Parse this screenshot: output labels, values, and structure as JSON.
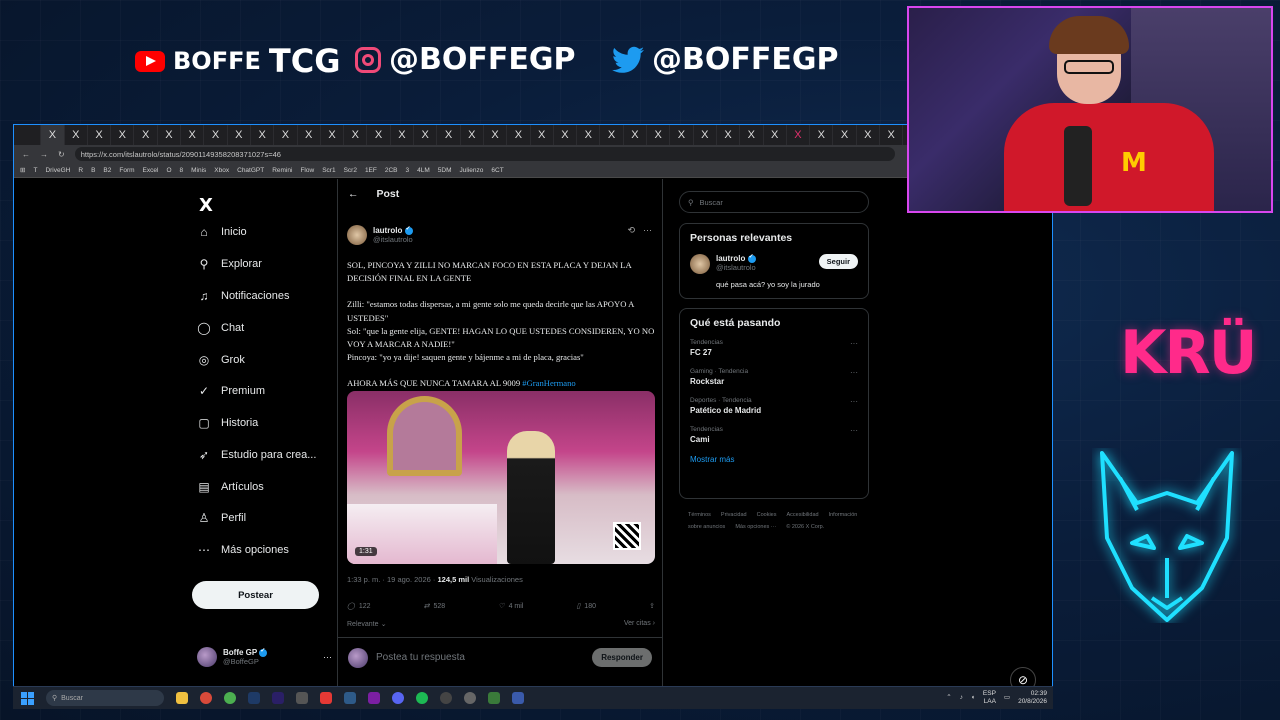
{
  "overlay": {
    "youtube": {
      "prefix": "BOFFE",
      "main": "TCG",
      "icon": "youtube-icon"
    },
    "instagram": {
      "handle": "@BOFFEGP",
      "icon": "instagram-icon"
    },
    "twitter": {
      "handle": "@BOFFEGP",
      "icon": "twitter-icon"
    },
    "kru_logo": "KRÜ",
    "accent_pink": "#ff2a8a",
    "accent_cyan": "#1fe0ff"
  },
  "browser": {
    "url": "https://x.com/itslautrolo/status/20901149358208371027s=46",
    "tabs": [
      "",
      "X",
      "X",
      "X",
      "X",
      "X",
      "X",
      "X",
      "X",
      "X",
      "X",
      "X",
      "X",
      "X",
      "X",
      "X",
      "X",
      "X",
      "X",
      "X",
      "X",
      "X",
      "X",
      "X",
      "X",
      "X",
      "X",
      "X",
      "X",
      "X",
      "X",
      "X",
      "X",
      "X",
      "X",
      "X",
      "X",
      "X",
      "X"
    ],
    "bookmarks": [
      "T",
      "DriveGH",
      "R",
      "B",
      "B2",
      "Form",
      "Excel",
      "O",
      "8",
      "Minis",
      "Xbox",
      "ChatGPT",
      "Remini",
      "Flow",
      "Scr1",
      "Scr2",
      "1EF",
      "2CB",
      "3",
      "4LM",
      "5DM",
      "Julienzo",
      "6CT"
    ]
  },
  "nav": {
    "logo": "X",
    "items": [
      {
        "label": "Inicio",
        "icon": "home-icon",
        "glyph": "⌂"
      },
      {
        "label": "Explorar",
        "icon": "search-icon",
        "glyph": "⚲"
      },
      {
        "label": "Notificaciones",
        "icon": "bell-icon",
        "glyph": "♫"
      },
      {
        "label": "Chat",
        "icon": "chat-icon",
        "glyph": "◯"
      },
      {
        "label": "Grok",
        "icon": "grok-icon",
        "glyph": "◎"
      },
      {
        "label": "Premium",
        "icon": "premium-icon",
        "glyph": "✓"
      },
      {
        "label": "Historia",
        "icon": "history-icon",
        "glyph": "▢"
      },
      {
        "label": "Estudio para crea...",
        "icon": "studio-icon",
        "glyph": "➶"
      },
      {
        "label": "Artículos",
        "icon": "articles-icon",
        "glyph": "▤"
      },
      {
        "label": "Perfil",
        "icon": "profile-icon",
        "glyph": "♙"
      },
      {
        "label": "Más opciones",
        "icon": "more-icon",
        "glyph": "⋯"
      }
    ],
    "post_button": "Postear",
    "account": {
      "name": "Boffe GP",
      "handle": "@BoffeGP",
      "more": "···"
    }
  },
  "post": {
    "header": "Post",
    "author": {
      "name": "lautrolo",
      "handle": "@itslautrolo"
    },
    "body": [
      "SOL, PINCOYA Y ZILLI NO MARCAN FOCO EN ESTA PLACA Y DEJAN LA DECISIÓN FINAL EN LA GENTE",
      "Zilli: \"estamos todas dispersas, a mi gente solo me queda decirle que las APOYO A USTEDES\"",
      "Sol: \"que la gente elija, GENTE! HAGAN LO QUE USTEDES CONSIDEREN, YO NO VOY A MARCAR A NADIE!\"",
      "Pincoya: \"yo ya dije! saquen gente y bájenme a mi de placa, gracias\""
    ],
    "closing": "AHORA MÁS QUE NUNCA TAMARA AL 9009 ",
    "hashtag": "#GranHermano",
    "video_duration": "1:31",
    "meta_time": "1:33 p. m. · 19 ago. 2026 · ",
    "views_count": "124,5 mil",
    "views_label": " Visualizaciones",
    "stats": {
      "replies": "122",
      "reposts": "528",
      "likes": "4 mil",
      "bookmarks": "180"
    },
    "sort": "Relevante",
    "quotes": "Ver citas",
    "reply_placeholder": "Postea tu respuesta",
    "reply_button": "Responder"
  },
  "sidebar": {
    "search_placeholder": "Buscar",
    "relevant": {
      "title": "Personas relevantes",
      "name": "lautrolo",
      "handle": "@itslautrolo",
      "follow": "Seguir",
      "bio": "qué pasa acá? yo soy la jurado"
    },
    "trends": {
      "title": "Qué está pasando",
      "items": [
        {
          "category": "Tendencias",
          "title": "FC 27"
        },
        {
          "category": "Gaming · Tendencia",
          "title": "Rockstar"
        },
        {
          "category": "Deportes · Tendencia",
          "title": "Patético de Madrid"
        },
        {
          "category": "Tendencias",
          "title": "Cami"
        }
      ],
      "show_more": "Mostrar más"
    },
    "footer": [
      "Términos",
      "Privacidad",
      "Cookies",
      "Accesibilidad",
      "Información sobre anuncios",
      "Más opciones ···",
      "© 2026 X Corp."
    ]
  },
  "taskbar": {
    "search": "Buscar",
    "lang": "ESP",
    "layout": "LAA",
    "time": "02:39",
    "date": "20/8/2026"
  }
}
